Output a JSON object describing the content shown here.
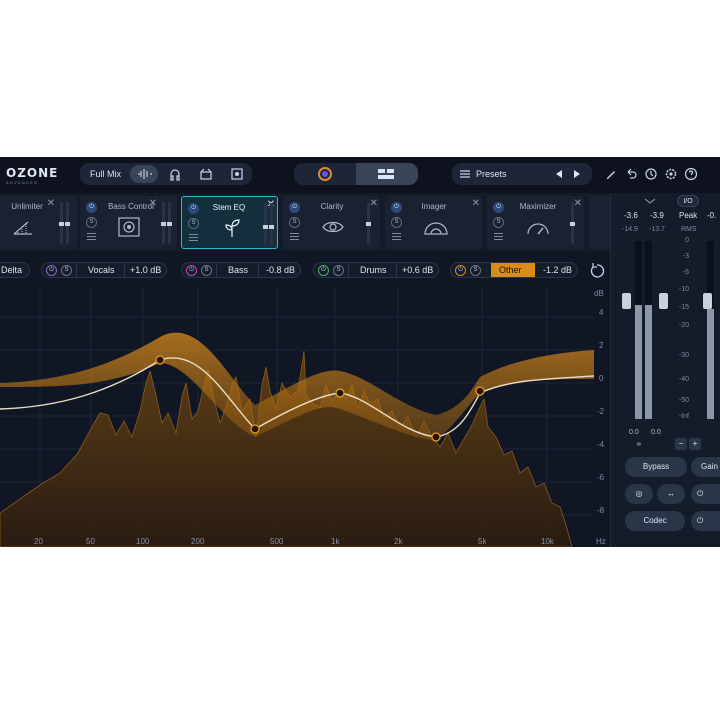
{
  "app": {
    "logo": "OZONE",
    "logo_sub": "ADVANCED",
    "mix_selector": "Full Mix",
    "presets_label": "Presets"
  },
  "modules": [
    {
      "name": "Unlimiter",
      "icon": "unlimiter-icon"
    },
    {
      "name": "Bass Control",
      "icon": "bass-control-icon"
    },
    {
      "name": "Stem EQ",
      "icon": "stem-eq-icon",
      "active": true
    },
    {
      "name": "Clarity",
      "icon": "eye-icon"
    },
    {
      "name": "Imager",
      "icon": "imager-icon"
    },
    {
      "name": "Maximizer",
      "icon": "gauge-icon"
    }
  ],
  "stems": {
    "delta": "Delta",
    "items": [
      {
        "name": "Vocals",
        "gain": "+1.0 dB",
        "color": "#8a63c9"
      },
      {
        "name": "Bass",
        "gain": "-0.8 dB",
        "color": "#c048b6"
      },
      {
        "name": "Drums",
        "gain": "+0.6 dB",
        "color": "#3bb86b"
      },
      {
        "name": "Other",
        "gain": "-1.2 dB",
        "color": "#d98c1a"
      }
    ]
  },
  "graph": {
    "db_unit": "dB",
    "db_ticks": [
      "4",
      "2",
      "0",
      "-2",
      "-4",
      "-6",
      "-8"
    ],
    "freq_ticks": [
      "20",
      "50",
      "100",
      "200",
      "500",
      "1k",
      "2k",
      "5k",
      "10k"
    ],
    "freq_unit": "Hz",
    "accent": "#d98c1a"
  },
  "meters": {
    "in_out_label": "I/O",
    "peak_label": "Peak",
    "rms_label": "RMS",
    "peak_left": "-3.6",
    "peak_right": "-3.9",
    "rms_left": "-14.9",
    "rms_right": "-13.7",
    "peak_next": "-0.",
    "scale": [
      "0",
      "-3",
      "-6",
      "-10",
      "-15",
      "-20",
      "-30",
      "-40",
      "-50",
      "-Inf"
    ],
    "readout_left": "0.0",
    "readout_right": "0.0",
    "bypass_label": "Bypass",
    "gain_label": "Gain M",
    "codec_label": "Codec",
    "left_level": 0.64,
    "right_level": 0.64
  }
}
